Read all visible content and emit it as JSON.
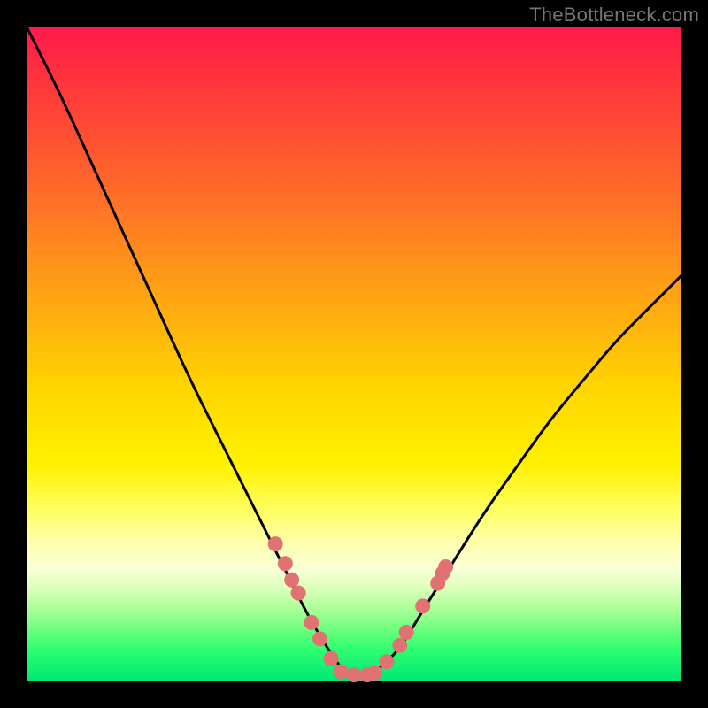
{
  "watermark": "TheBottleneck.com",
  "colors": {
    "frame_bg": "#000000",
    "curve_stroke": "#000000",
    "marker_fill": "#e27272",
    "marker_stroke": "#d85a5a"
  },
  "chart_data": {
    "type": "line",
    "title": "",
    "xlabel": "",
    "ylabel": "",
    "xlim": [
      0,
      100
    ],
    "ylim": [
      0,
      100
    ],
    "grid": false,
    "legend": false,
    "series": [
      {
        "name": "bottleneck-curve",
        "x": [
          0,
          5,
          10,
          15,
          20,
          25,
          30,
          35,
          40,
          43,
          46,
          48,
          50,
          52,
          54,
          57,
          60,
          65,
          70,
          75,
          80,
          85,
          90,
          95,
          100
        ],
        "values": [
          100,
          90,
          79,
          68,
          57,
          46,
          36,
          26,
          16,
          10,
          5,
          2,
          1,
          1,
          2,
          5,
          10,
          18,
          26,
          33,
          40,
          46,
          52,
          57,
          62
        ]
      }
    ],
    "scatter_markers": {
      "name": "highlighted-points",
      "points": [
        {
          "x": 38.0,
          "y": 21.0
        },
        {
          "x": 39.5,
          "y": 18.0
        },
        {
          "x": 40.5,
          "y": 15.5
        },
        {
          "x": 41.5,
          "y": 13.5
        },
        {
          "x": 43.5,
          "y": 9.0
        },
        {
          "x": 44.8,
          "y": 6.5
        },
        {
          "x": 46.5,
          "y": 3.5
        },
        {
          "x": 48.0,
          "y": 1.5
        },
        {
          "x": 50.0,
          "y": 1.0
        },
        {
          "x": 52.0,
          "y": 1.0
        },
        {
          "x": 53.2,
          "y": 1.3
        },
        {
          "x": 55.0,
          "y": 3.0
        },
        {
          "x": 57.0,
          "y": 5.5
        },
        {
          "x": 58.0,
          "y": 7.5
        },
        {
          "x": 60.5,
          "y": 11.5
        },
        {
          "x": 62.8,
          "y": 15.0
        },
        {
          "x": 63.5,
          "y": 16.5
        },
        {
          "x": 64.0,
          "y": 17.5
        }
      ]
    }
  }
}
